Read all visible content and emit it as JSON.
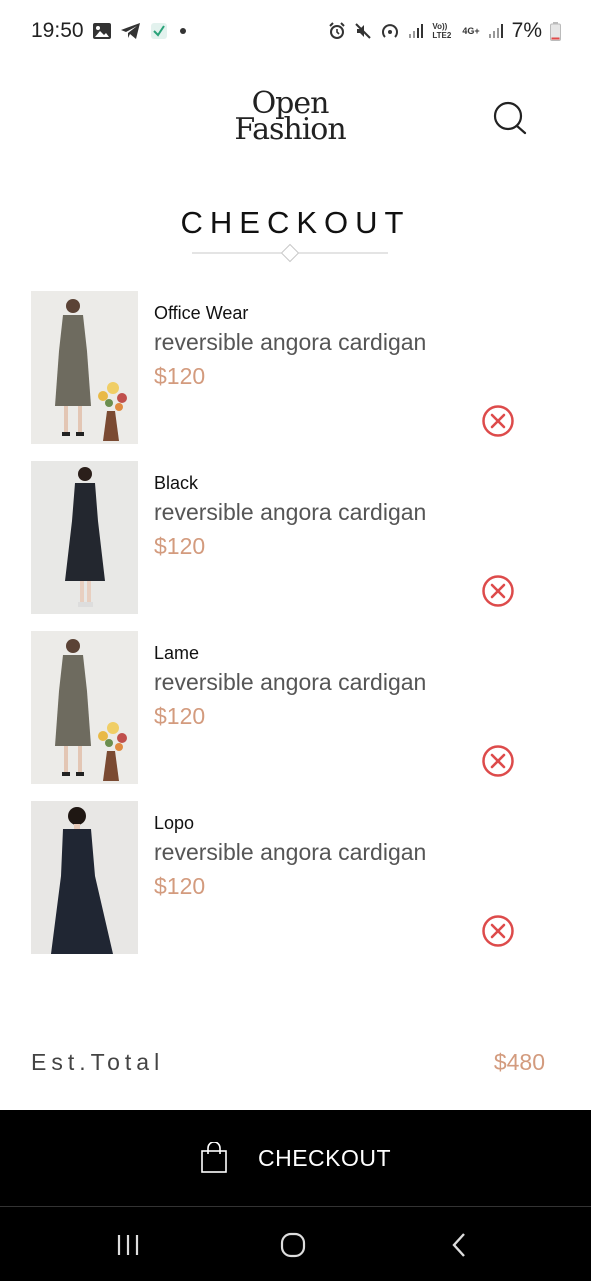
{
  "status_bar": {
    "time": "19:50",
    "battery": "7%",
    "volte_label": "Vo)) LTE2",
    "network_label": "4G+"
  },
  "brand": {
    "logo_line1": "Open",
    "logo_line2": "Fashion"
  },
  "page": {
    "title": "CHECKOUT"
  },
  "cart_items": [
    {
      "category": "Office Wear",
      "name": "reversible angora cardigan",
      "price": "$120",
      "dress_color": "#6e6b5f"
    },
    {
      "category": "Black",
      "name": "reversible angora cardigan",
      "price": "$120",
      "dress_color": "#23272f"
    },
    {
      "category": "Lame",
      "name": "reversible angora cardigan",
      "price": "$120",
      "dress_color": "#6e6b5f"
    },
    {
      "category": "Lopo",
      "name": "reversible angora cardigan",
      "price": "$120",
      "dress_color": "#202633"
    }
  ],
  "summary": {
    "total_label": "Est.Total",
    "total_value": "$480"
  },
  "checkout_button": {
    "label": "CHECKOUT"
  },
  "colors": {
    "accent_price": "#d39b7e",
    "remove_icon": "#dd4b4b",
    "checkout_bg": "#000000"
  }
}
